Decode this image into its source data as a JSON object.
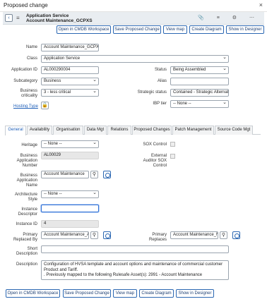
{
  "window": {
    "title": "Proposed change",
    "close": "×"
  },
  "header": {
    "line1": "Application Service",
    "line2": "Account Maintenance_GCPXS",
    "back": "‹",
    "menu": "≡",
    "icons": "📎 ≡ ⚙ ⋯"
  },
  "actions": {
    "open_cmdb": "Open in CMDB Workspace",
    "save_proposed": "Save Proposed Change",
    "view_map": "View map",
    "create_diagram": "Create Diagram",
    "show_designer": "Show in Designer"
  },
  "form": {
    "name_label": "Name",
    "name_value": "Account Maintenance_GCPXS",
    "class_label": "Class",
    "class_value": "Application Service",
    "appid_label": "Application ID",
    "appid_value": "AL000290004",
    "status_label": "Status",
    "status_value": "Being Assembled",
    "subcat_label": "Subcategory",
    "subcat_value": "Business",
    "alias_label": "Alias",
    "alias_value": "",
    "crit_label_1": "Business",
    "crit_label_2": "criticality",
    "crit_value": "3 - less critical",
    "strat_label": "Strategic status",
    "strat_value": "Contained - Strategic Alternati",
    "hosting_link": "Hosting Type",
    "ibp_label": "IBP tier",
    "ibp_value": "-- None --"
  },
  "tabs": [
    "General",
    "Availability",
    "Organisation",
    "Data Mgt",
    "Relations",
    "Proposed Changes",
    "Patch Management",
    "Source Code Mgt"
  ],
  "general": {
    "heritage_label": "Heritage",
    "heritage_value": "-- None --",
    "sox_label": "SOX Control",
    "ban_label": [
      "Business",
      "Application",
      "Number"
    ],
    "ban_value": "AL00029",
    "ext_label": [
      "External",
      "Auditor SOX",
      "Control"
    ],
    "bapp_label": [
      "Business",
      "Application",
      "Name"
    ],
    "bapp_value": "Account Maintenance",
    "arch_label": [
      "Architecture",
      "Style"
    ],
    "arch_value": "-- None --",
    "inst_desc_label": [
      "Instance",
      "Descriptor"
    ],
    "inst_desc_value": "",
    "inst_id_label": "Instance ID",
    "inst_id_value": "4",
    "prb_label": [
      "Primary",
      "Replaced By"
    ],
    "prb_value": "Account Maintenance_A",
    "pr_label": [
      "Primary",
      "Replaces"
    ],
    "pr_value": "Account Maintenance_N",
    "short_label": [
      "Short",
      "Description"
    ],
    "short_value": "",
    "desc_label": "Description",
    "desc_lines": [
      "Configuration of HVSA template and account options and maintenance of commercial customer",
      "Product and Tariff.",
      ". Previously mapped to the following Rulesafe Asset(s): 2991 - Account Maintenance"
    ]
  }
}
